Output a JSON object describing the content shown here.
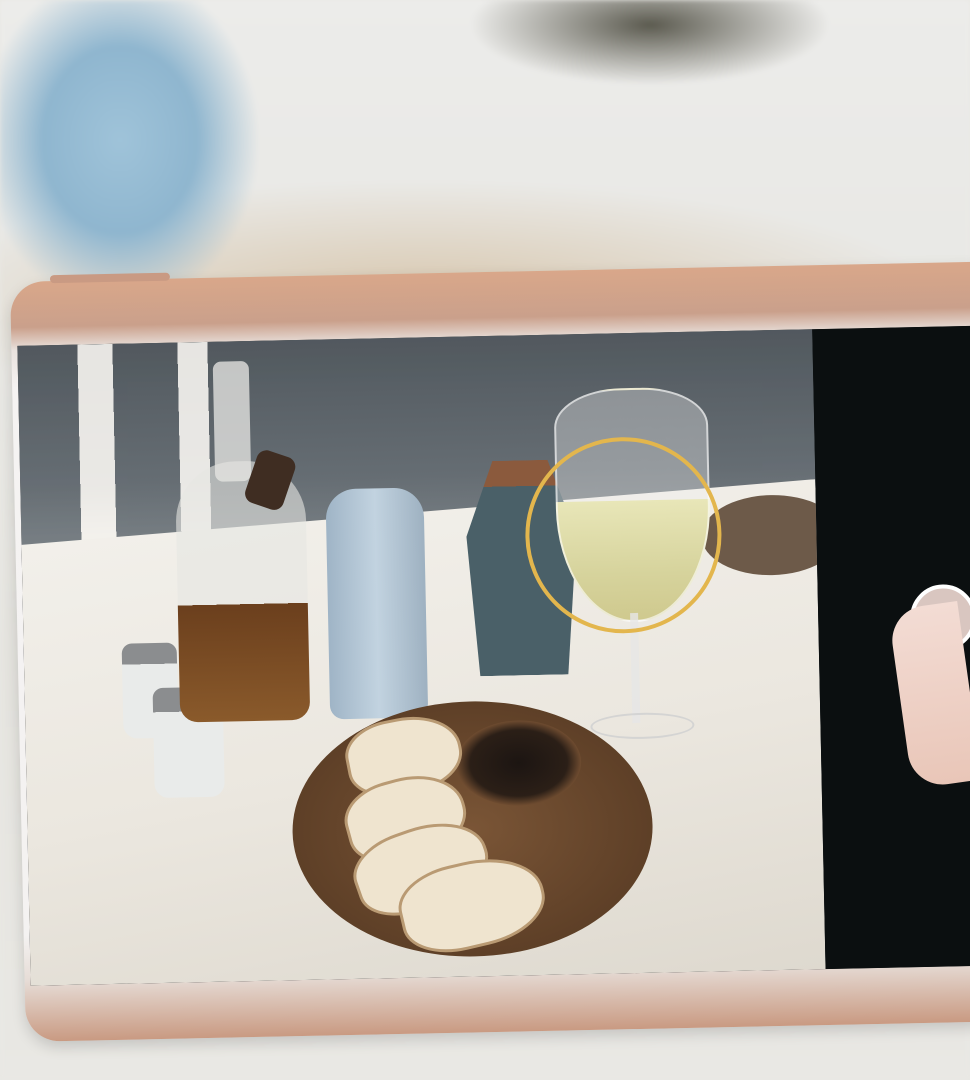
{
  "scene": {
    "ring_color": "#e3b64d",
    "phone_color": "#d9a78a",
    "icons": [
      "shutter-icon"
    ]
  }
}
